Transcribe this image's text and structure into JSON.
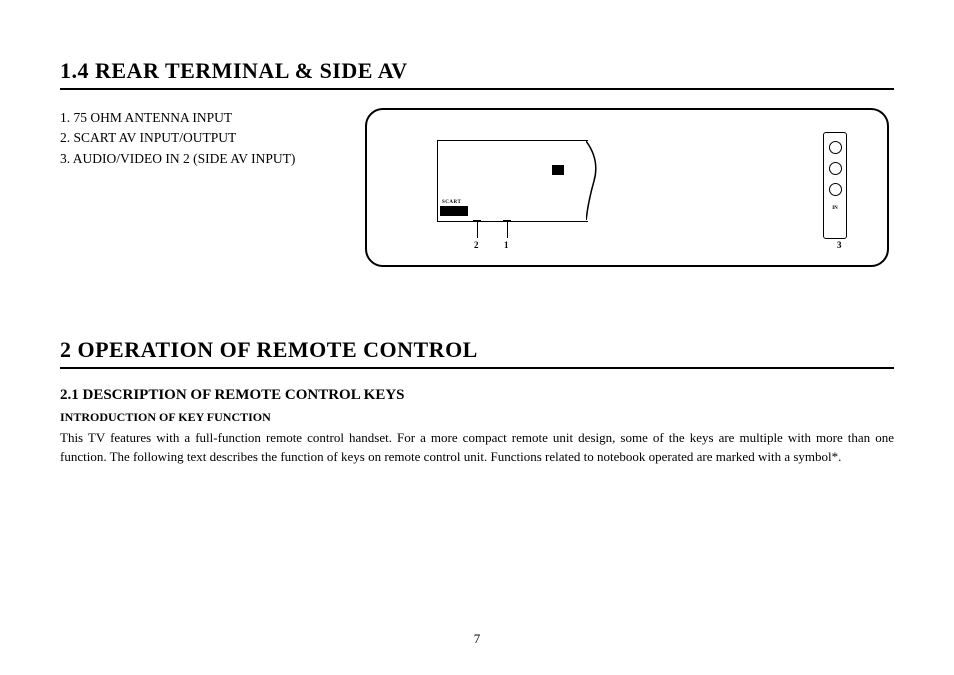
{
  "section1": {
    "heading": "1.4 REAR TERMINAL & SIDE AV",
    "list": {
      "item1": "1.  75 OHM ANTENNA INPUT",
      "item2": "2.  SCART AV INPUT/OUTPUT",
      "item3": "3.  AUDIO/VIDEO IN 2 (SIDE AV INPUT)"
    },
    "diagram": {
      "scart_label": "SCART",
      "in_label": "IN",
      "callout_1": "1",
      "callout_2": "2",
      "callout_3": "3"
    }
  },
  "section2": {
    "heading": "2 OPERATION OF REMOTE CONTROL",
    "sub_heading": "2.1 DESCRIPTION OF REMOTE CONTROL KEYS",
    "intro_label": "INTRODUCTION OF KEY FUNCTION",
    "body": "This TV features with a full-function remote control handset. For a more compact remote unit design, some of the keys are multiple with more than one function. The following text describes the function of keys on remote control unit. Functions related to notebook operated are marked with a symbol*."
  },
  "page_number": "7"
}
